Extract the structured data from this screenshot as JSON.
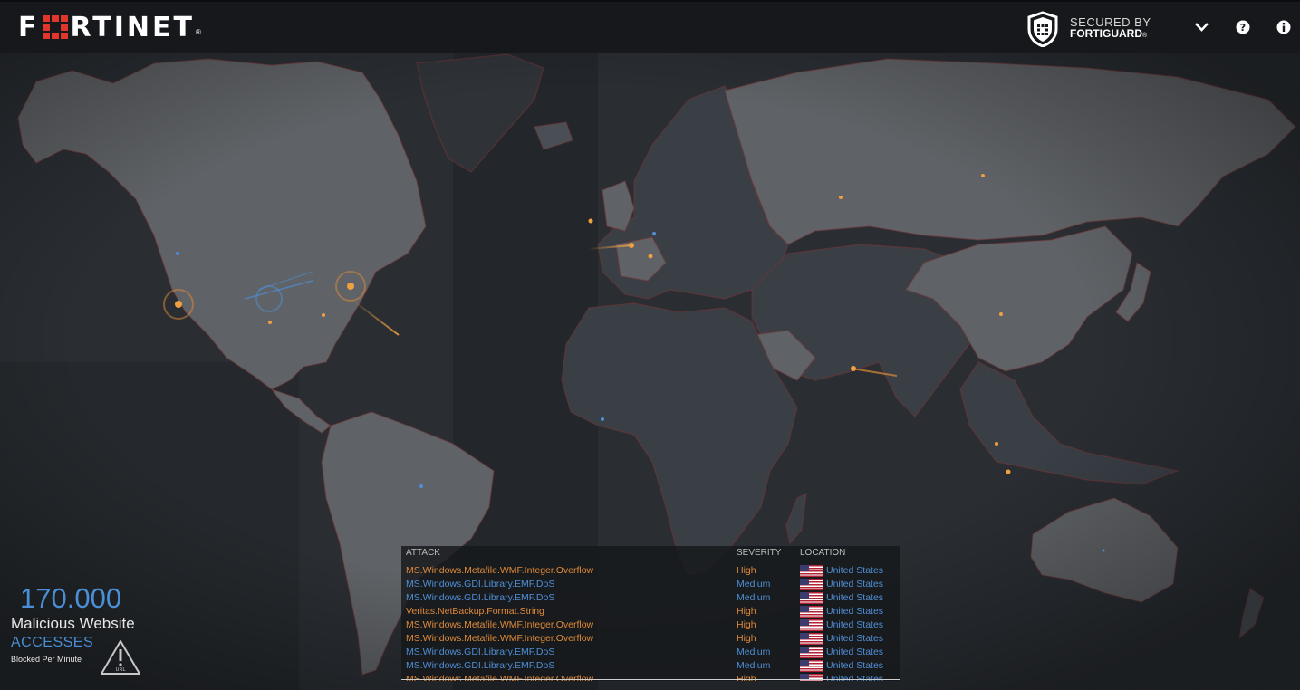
{
  "header": {
    "logo_text": "F RTINET",
    "logo_reg": "®",
    "secured_line1": "SECURED BY",
    "secured_line2": "FORTIGUARD",
    "secured_reg": "®",
    "icons": [
      "fortiguard-shield-icon",
      "chevron-down-icon",
      "help-icon",
      "info-icon"
    ]
  },
  "table": {
    "headers": {
      "attack": "ATTACK",
      "severity": "SEVERITY",
      "location": "LOCATION"
    },
    "rows": [
      {
        "attack": "MS.Windows.Metafile.WMF.Integer.Overflow",
        "severity": "High",
        "location": "United States"
      },
      {
        "attack": "MS.Windows.GDI.Library.EMF.DoS",
        "severity": "Medium",
        "location": "United States"
      },
      {
        "attack": "MS.Windows.GDI.Library.EMF.DoS",
        "severity": "Medium",
        "location": "United States"
      },
      {
        "attack": "Veritas.NetBackup.Format.String",
        "severity": "High",
        "location": "United States"
      },
      {
        "attack": "MS.Windows.Metafile.WMF.Integer.Overflow",
        "severity": "High",
        "location": "United States"
      },
      {
        "attack": "MS.Windows.Metafile.WMF.Integer.Overflow",
        "severity": "High",
        "location": "United States"
      },
      {
        "attack": "MS.Windows.GDI.Library.EMF.DoS",
        "severity": "Medium",
        "location": "United States"
      },
      {
        "attack": "MS.Windows.GDI.Library.EMF.DoS",
        "severity": "Medium",
        "location": "United States"
      },
      {
        "attack": "MS.Windows.Metafile.WMF.Integer.Overflow",
        "severity": "High",
        "location": "United States"
      }
    ]
  },
  "stats": {
    "count": "170.000",
    "label": "Malicious Website",
    "accesses": "ACCESSES",
    "sub": "Blocked Per Minute",
    "warn_label": "URL"
  },
  "colors": {
    "high": "#e08a38",
    "medium": "#4f8fd6",
    "accent": "#4a8fd6",
    "logo_red": "#e0362b"
  }
}
